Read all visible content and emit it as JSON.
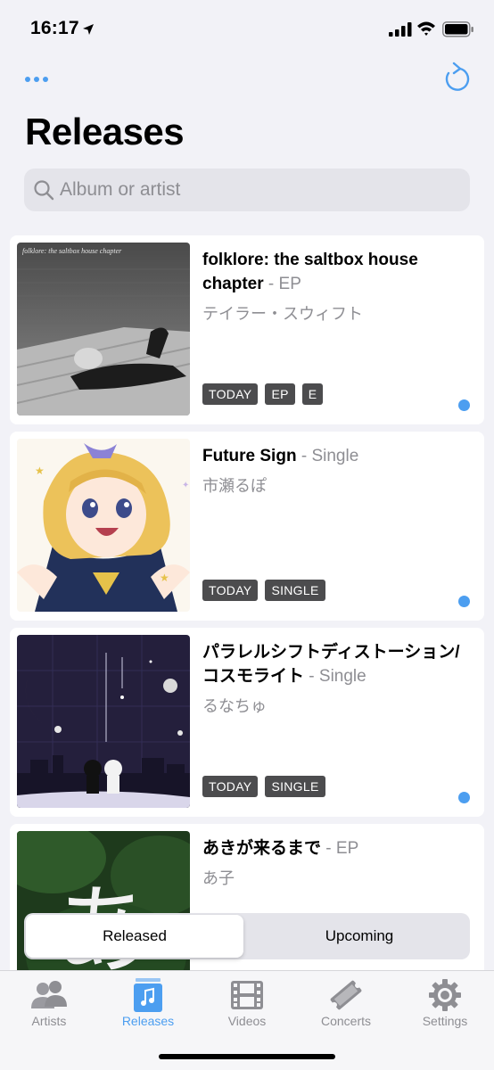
{
  "status_bar": {
    "time": "16:17"
  },
  "header": {
    "title": "Releases"
  },
  "search": {
    "placeholder": "Album or artist",
    "value": ""
  },
  "releases": [
    {
      "title": "folklore: the saltbox house chapter",
      "type": "EP",
      "artist": "テイラー・スウィフト",
      "tags": [
        "TODAY",
        "EP",
        "E"
      ],
      "artwork_text": "folklore: the saltbox house chapter",
      "unread": true
    },
    {
      "title": "Future Sign",
      "type": "Single",
      "artist": "市瀬るぽ",
      "tags": [
        "TODAY",
        "SINGLE"
      ],
      "unread": true
    },
    {
      "title": "パラレルシフトディストーション/コスモライト",
      "type": "Single",
      "artist": "るなちゅ",
      "tags": [
        "TODAY",
        "SINGLE"
      ],
      "unread": true
    },
    {
      "title": "あきが来るまで",
      "type": "EP",
      "artist": "あ子",
      "tags": [],
      "artwork_text": "あ",
      "unread": false
    }
  ],
  "segments": {
    "released": "Released",
    "upcoming": "Upcoming",
    "selected": "Released"
  },
  "tabs": [
    {
      "label": "Artists",
      "icon": "people-icon",
      "active": false
    },
    {
      "label": "Releases",
      "icon": "music-note-icon",
      "active": true
    },
    {
      "label": "Videos",
      "icon": "film-icon",
      "active": false
    },
    {
      "label": "Concerts",
      "icon": "ticket-icon",
      "active": false
    },
    {
      "label": "Settings",
      "icon": "gear-icon",
      "active": false
    }
  ],
  "colors": {
    "accent": "#4c9ef0",
    "tag_bg": "#4c4c4e",
    "secondary_text": "#8e8e93"
  }
}
